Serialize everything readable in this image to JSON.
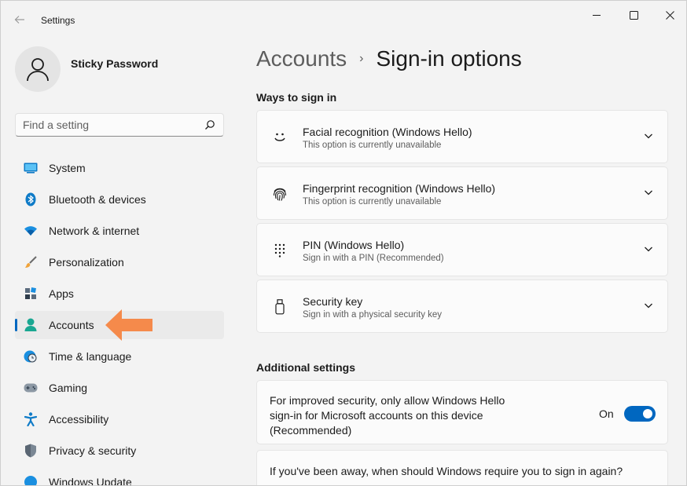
{
  "window": {
    "title": "Settings"
  },
  "profile": {
    "name": "Sticky Password"
  },
  "search": {
    "placeholder": "Find a setting"
  },
  "sidebar": {
    "items": [
      {
        "label": "System",
        "icon": "system-icon"
      },
      {
        "label": "Bluetooth & devices",
        "icon": "bluetooth-icon"
      },
      {
        "label": "Network & internet",
        "icon": "wifi-icon"
      },
      {
        "label": "Personalization",
        "icon": "brush-icon"
      },
      {
        "label": "Apps",
        "icon": "apps-icon"
      },
      {
        "label": "Accounts",
        "icon": "accounts-icon",
        "selected": true
      },
      {
        "label": "Time & language",
        "icon": "clock-globe-icon"
      },
      {
        "label": "Gaming",
        "icon": "controller-icon"
      },
      {
        "label": "Accessibility",
        "icon": "accessibility-icon"
      },
      {
        "label": "Privacy & security",
        "icon": "shield-icon"
      },
      {
        "label": "Windows Update",
        "icon": "update-icon"
      }
    ]
  },
  "breadcrumb": {
    "parent": "Accounts",
    "separator": "›",
    "current": "Sign-in options"
  },
  "ways_to_sign_in": {
    "heading": "Ways to sign in",
    "options": [
      {
        "title": "Facial recognition (Windows Hello)",
        "subtitle": "This option is currently unavailable",
        "icon": "face-icon"
      },
      {
        "title": "Fingerprint recognition (Windows Hello)",
        "subtitle": "This option is currently unavailable",
        "icon": "fingerprint-icon"
      },
      {
        "title": "PIN (Windows Hello)",
        "subtitle": "Sign in with a PIN (Recommended)",
        "icon": "pin-keypad-icon"
      },
      {
        "title": "Security key",
        "subtitle": "Sign in with a physical security key",
        "icon": "usb-key-icon"
      }
    ]
  },
  "additional_settings": {
    "heading": "Additional settings",
    "hello_only": {
      "text": "For improved security, only allow Windows Hello sign-in for Microsoft accounts on this device (Recommended)",
      "state_label": "On",
      "on": true
    },
    "away": {
      "text": "If you've been away, when should Windows require you to sign in again?"
    }
  },
  "colors": {
    "accent": "#0067c0",
    "annotation_arrow": "#f58a4b"
  }
}
